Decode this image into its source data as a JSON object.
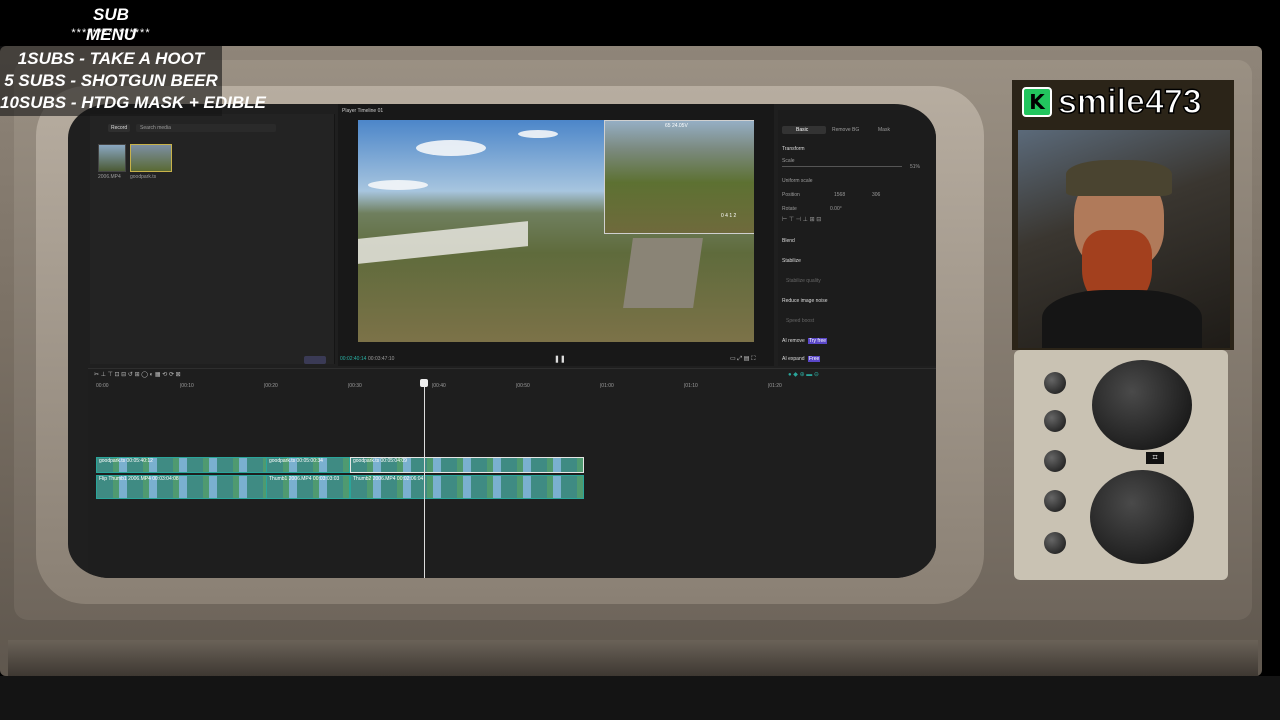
{
  "overlay": {
    "title": "SUB MENU",
    "stars": "***************",
    "lines": [
      "1SUBS   - TAKE A HOOT",
      "5 SUBS  - SHOTGUN BEER",
      "10SUBS - HTDG MASK + EDIBLE"
    ]
  },
  "editor": {
    "media": {
      "record_label": "Record",
      "search_placeholder": "Search media",
      "thumbs": [
        "2006.MP4",
        "goodpark.ts"
      ]
    },
    "player": {
      "title": "Player Timeline 01",
      "current_time": "00:02:40:14",
      "total_time": "00:03:47:10",
      "osd": "65 24.05V",
      "osd_right": "0 4  1 2"
    },
    "properties": {
      "tabs": [
        "Basic",
        "Remove BG",
        "Mask"
      ],
      "transform_label": "Transform",
      "scale_label": "Scale",
      "scale_value": "51%",
      "uniform_scale_label": "Uniform scale",
      "position_label": "Position",
      "position_x": "1568",
      "position_y": "306",
      "rotate_label": "Rotate",
      "rotate_value": "0.00°",
      "blend_label": "Blend",
      "stabilize_label": "Stabilize",
      "stabilize_sub": "Stabilize quality",
      "reduce_noise_label": "Reduce image noise",
      "speed_label": "Speed boost",
      "ai_remove_label": "AI remove",
      "ai_remove_badge": "Try free",
      "ai_expand_label": "AI expand",
      "ai_expand_badge": "Free"
    },
    "timeline": {
      "ruler": [
        "00:00",
        "|00:10",
        "|00:20",
        "|00:30",
        "|00:40",
        "|00:50",
        "|01:00",
        "|01:10",
        "|01:20"
      ],
      "clip_labels": [
        "goodpark.ts  00:05:40:12",
        "goodpark.ts  00:05:00:34",
        "goodpark.ts  00:05:04:09"
      ],
      "video_labels": [
        "Flip  Thumb1 2006.MP4  00:03:04:08",
        "Thumb1 2006.MP4  00:03:03:03",
        "Thumb2 2006.MP4  00:02:06:04"
      ]
    }
  },
  "stream": {
    "brand_icon": "K",
    "channel_name": "smile473"
  },
  "colors": {
    "accent_teal": "#2aa59a",
    "brand_green": "#22c55e"
  }
}
